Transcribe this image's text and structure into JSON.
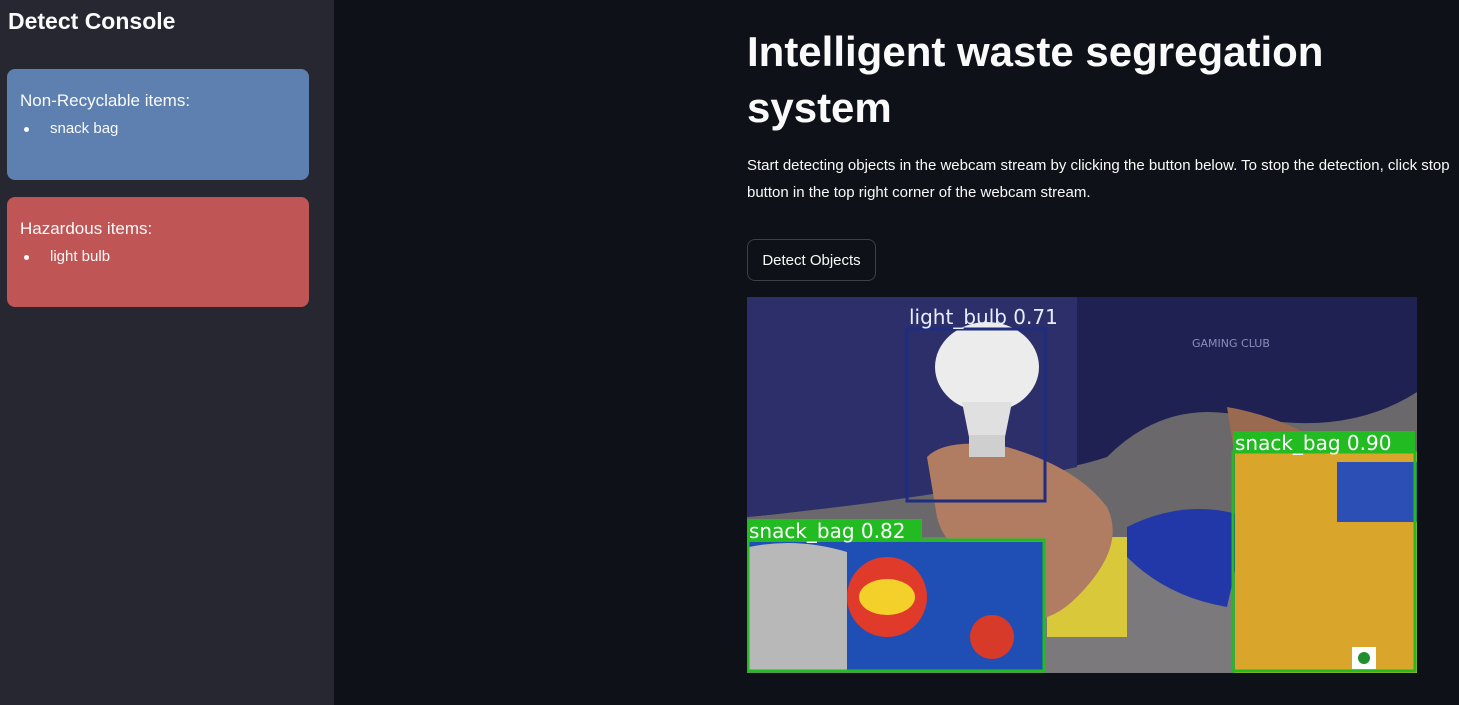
{
  "sidebar": {
    "title": "Detect Console",
    "cards": [
      {
        "heading": "Non-Recyclable items:",
        "items": [
          "snack bag"
        ],
        "color": "#5e80b0"
      },
      {
        "heading": "Hazardous items:",
        "items": [
          "light bulb"
        ],
        "color": "#c05555"
      }
    ]
  },
  "main": {
    "title": "Intelligent waste segregation system",
    "description": "Start detecting objects in the webcam stream by clicking the button below. To stop the detection, click stop button in the top right corner of the webcam stream.",
    "detect_button": "Detect Objects"
  },
  "stream": {
    "detections": [
      {
        "label": "light_bulb 0.71",
        "color": "#1e2d80"
      },
      {
        "label": "snack_bag 0.90",
        "color": "#22bb22"
      },
      {
        "label": "snack_bag 0.82",
        "color": "#22bb22"
      }
    ],
    "shirt_text": "GAMING CLUB"
  }
}
